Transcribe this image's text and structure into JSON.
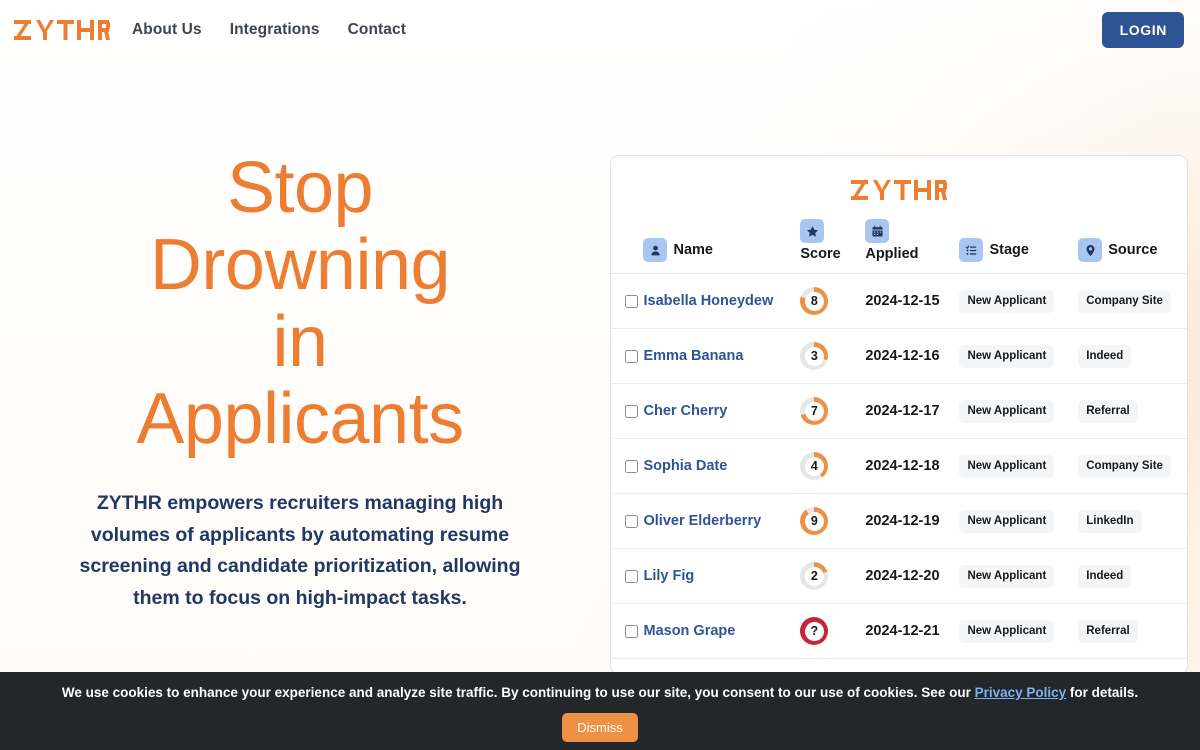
{
  "brand": {
    "name": "ZYTHR",
    "logo_color": "#ed7d31"
  },
  "nav": {
    "links": [
      {
        "label": "About Us"
      },
      {
        "label": "Integrations"
      },
      {
        "label": "Contact"
      }
    ],
    "login_label": "LOGIN",
    "login_color": "#2f5496"
  },
  "hero": {
    "title_lines": [
      "Stop",
      "Drowning",
      "in",
      "Applicants"
    ],
    "title_color": "#ed7d31",
    "subtitle": "ZYTHR empowers recruiters managing high volumes of applicants by automating resume screening and candidate prioritization, allowing them to focus on high-impact tasks.",
    "subtitle_color": "#1f3864"
  },
  "table": {
    "columns": [
      {
        "key": "check",
        "label": "",
        "icon": ""
      },
      {
        "key": "name",
        "label": "Name",
        "icon": "person-icon"
      },
      {
        "key": "score",
        "label": "Score",
        "icon": "star-icon"
      },
      {
        "key": "applied",
        "label": "Applied",
        "icon": "calendar-icon"
      },
      {
        "key": "stage",
        "label": "Stage",
        "icon": "list-icon"
      },
      {
        "key": "source",
        "label": "Source",
        "icon": "map-pin-icon"
      }
    ],
    "score_max": 10,
    "score_arc_color": "#ed9144",
    "score_track_color": "#e6e6e6",
    "score_unknown_color": "#c2283c",
    "rows": [
      {
        "name": "Isabella Honeydew",
        "score": "8",
        "applied": "2024-12-15",
        "stage": "New Applicant",
        "source": "Company Site"
      },
      {
        "name": "Emma Banana",
        "score": "3",
        "applied": "2024-12-16",
        "stage": "New Applicant",
        "source": "Indeed"
      },
      {
        "name": "Cher Cherry",
        "score": "7",
        "applied": "2024-12-17",
        "stage": "New Applicant",
        "source": "Referral"
      },
      {
        "name": "Sophia Date",
        "score": "4",
        "applied": "2024-12-18",
        "stage": "New Applicant",
        "source": "Company Site"
      },
      {
        "name": "Oliver Elderberry",
        "score": "9",
        "applied": "2024-12-19",
        "stage": "New Applicant",
        "source": "LinkedIn"
      },
      {
        "name": "Lily Fig",
        "score": "2",
        "applied": "2024-12-20",
        "stage": "New Applicant",
        "source": "Indeed"
      },
      {
        "name": "Mason Grape",
        "score": "?",
        "applied": "2024-12-21",
        "stage": "New Applicant",
        "source": "Referral"
      }
    ]
  },
  "cookie": {
    "text_before": "We use cookies to enhance your experience and analyze site traffic. By continuing to use our site, you consent to our use of cookies. See our ",
    "link_label": "Privacy Policy",
    "text_after": " for details.",
    "dismiss_label": "Dismiss",
    "dismiss_color": "#ed9144"
  }
}
